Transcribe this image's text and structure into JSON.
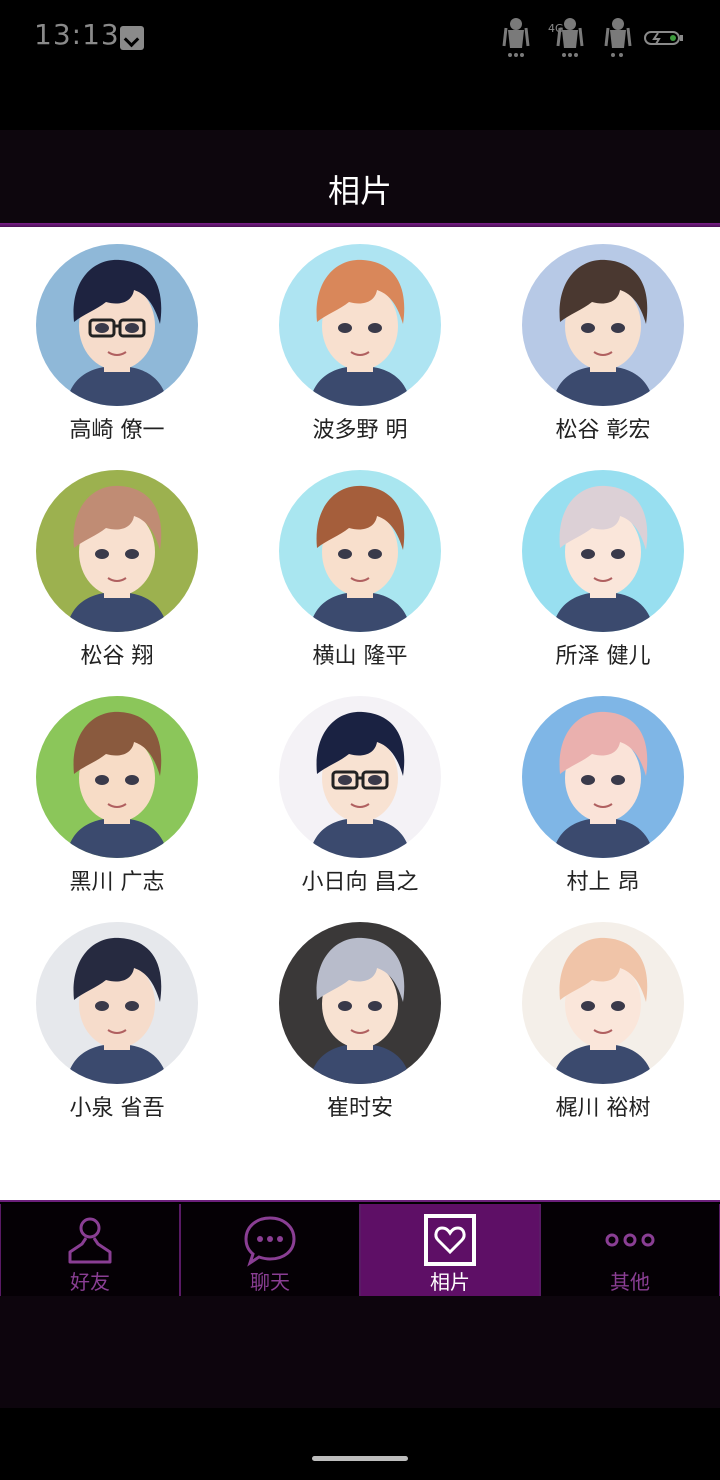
{
  "status_bar": {
    "time": "13:13",
    "network_badge": "4G",
    "icons": [
      "notification-icon",
      "figure-signal-icon",
      "figure-signal-icon",
      "figure-wifi-icon",
      "battery-charging-icon"
    ]
  },
  "header": {
    "title": "相片"
  },
  "contacts": [
    {
      "name": "高崎 僚一",
      "colors": {
        "hair": "#1e2340",
        "bg": "#8fb8d8",
        "skin": "#f6dccb"
      },
      "glasses": true
    },
    {
      "name": "波多野 明",
      "colors": {
        "hair": "#d9875a",
        "bg": "#aee4f2",
        "skin": "#f8e0cf"
      },
      "glasses": false
    },
    {
      "name": "松谷 彰宏",
      "colors": {
        "hair": "#4a3830",
        "bg": "#b7c9e6",
        "skin": "#f7e0cf"
      },
      "glasses": false
    },
    {
      "name": "松谷 翔",
      "colors": {
        "hair": "#c08c74",
        "bg": "#9cb14f",
        "skin": "#f8e0cf"
      },
      "glasses": false
    },
    {
      "name": "横山 隆平",
      "colors": {
        "hair": "#a55e3b",
        "bg": "#a9e6f0",
        "skin": "#f8dfcc"
      },
      "glasses": false
    },
    {
      "name": "所泽 健儿",
      "colors": {
        "hair": "#dcd0d6",
        "bg": "#98dff0",
        "skin": "#fae6da"
      },
      "glasses": false
    },
    {
      "name": "黑川 广志",
      "colors": {
        "hair": "#8a5a3e",
        "bg": "#8bc65a",
        "skin": "#f7dcc6"
      },
      "glasses": false
    },
    {
      "name": "小日向 昌之",
      "colors": {
        "hair": "#1a2242",
        "bg": "#f4f2f6",
        "skin": "#f8e2d2"
      },
      "glasses": true
    },
    {
      "name": "村上 昂",
      "colors": {
        "hair": "#eab0ae",
        "bg": "#7fb6e6",
        "skin": "#fae3d8"
      },
      "glasses": false
    },
    {
      "name": "小泉 省吾",
      "colors": {
        "hair": "#262a40",
        "bg": "#e6e8ec",
        "skin": "#f6dccb"
      },
      "glasses": false
    },
    {
      "name": "崔时安",
      "colors": {
        "hair": "#b8bccb",
        "bg": "#3a3838",
        "skin": "#f8e2d2"
      },
      "glasses": false
    },
    {
      "name": "梶川 裕树",
      "colors": {
        "hair": "#f0c4a8",
        "bg": "#f4efe9",
        "skin": "#fae6da"
      },
      "glasses": false
    }
  ],
  "bottom_nav": {
    "tabs": [
      {
        "label": "好友",
        "icon": "person-icon",
        "active": false
      },
      {
        "label": "聊天",
        "icon": "chat-bubble-icon",
        "active": false
      },
      {
        "label": "相片",
        "icon": "heart-photo-icon",
        "active": true
      },
      {
        "label": "其他",
        "icon": "more-dots-icon",
        "active": false
      }
    ]
  },
  "colors": {
    "accent": "#5e0f66",
    "accent_line": "#7a1f8a",
    "tab_label_inactive": "#8a3e94"
  }
}
